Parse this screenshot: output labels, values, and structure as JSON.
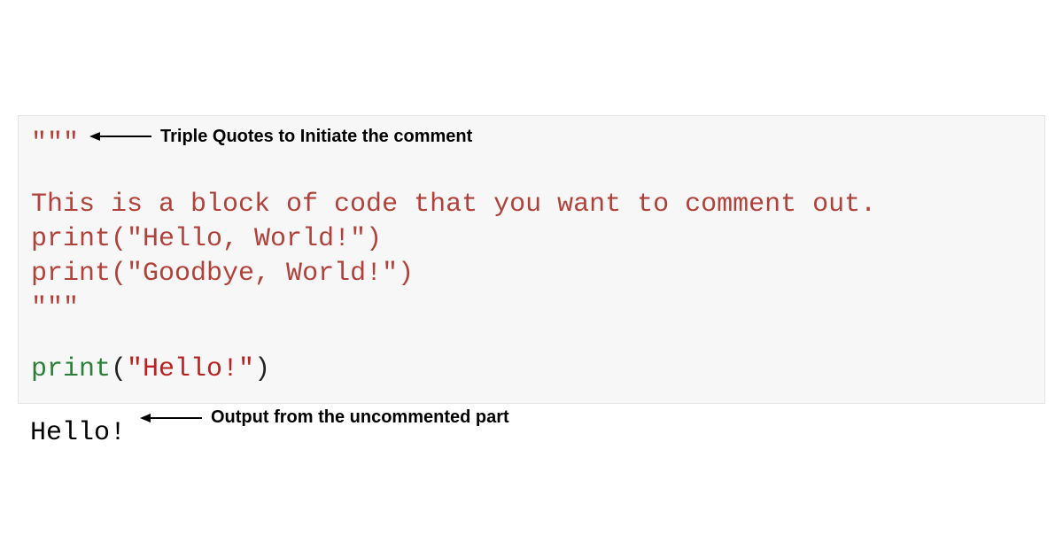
{
  "code": {
    "triple_quote_open": "\"\"\"",
    "comment_line_1": "This is a block of code that you want to comment out.",
    "comment_line_2_fn": "print",
    "comment_line_2_str": "\"Hello, World!\"",
    "comment_line_3_fn": "print",
    "comment_line_3_str": "\"Goodbye, World!\"",
    "triple_quote_close": "\"\"\"",
    "active_line_fn": "print",
    "active_line_str": "\"Hello!\""
  },
  "output": {
    "text": "Hello!"
  },
  "annotations": {
    "triple_quote_label": "Triple Quotes to Initiate the comment",
    "output_label": "Output from the uncommented part"
  }
}
